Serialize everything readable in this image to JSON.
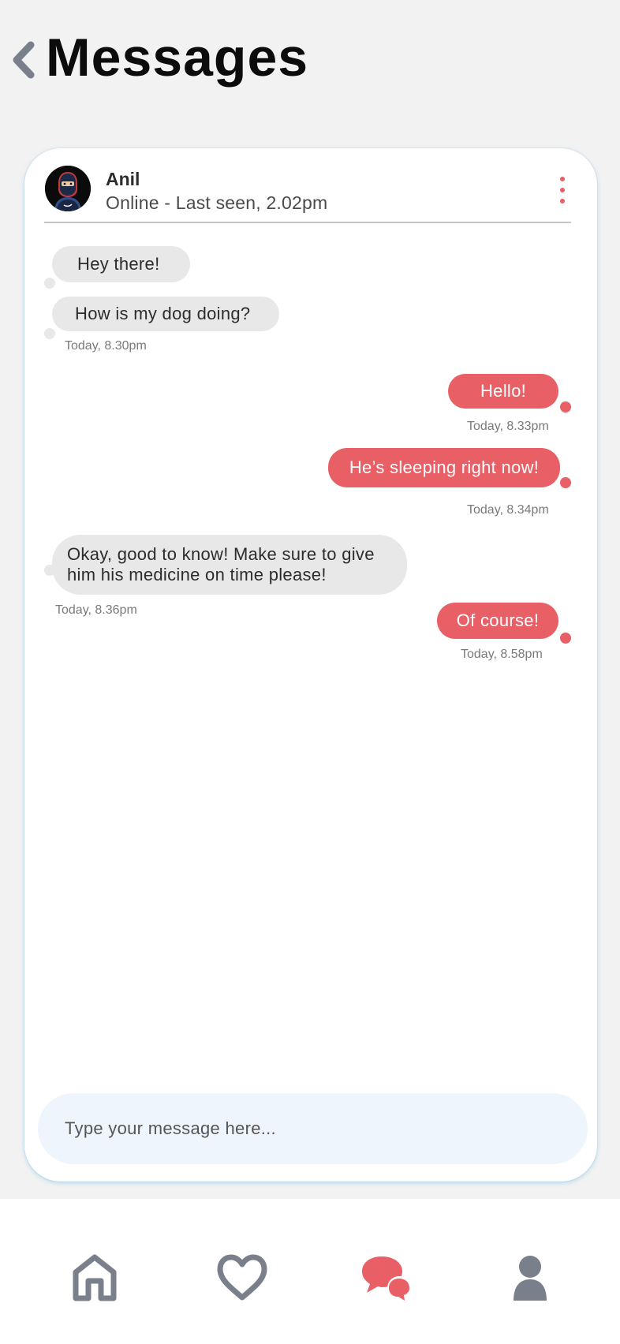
{
  "header": {
    "title": "Messages",
    "back_icon": "chevron-left-icon"
  },
  "contact": {
    "name": "Anil",
    "status": "Online - Last seen, 2.02pm",
    "avatar_icon": "ninja-avatar"
  },
  "messages": [
    {
      "direction": "incoming",
      "text": "Hey there!"
    },
    {
      "direction": "incoming",
      "text": "How is my dog doing?",
      "time": "Today, 8.30pm"
    },
    {
      "direction": "outgoing",
      "text": "Hello!",
      "time": "Today, 8.33pm"
    },
    {
      "direction": "outgoing",
      "text": "He’s sleeping right now!",
      "time": "Today, 8.34pm"
    },
    {
      "direction": "incoming",
      "text_lines": [
        "Okay, good to know! Make sure to give",
        "him his medicine on time please!"
      ],
      "time": "Today, 8.36pm"
    },
    {
      "direction": "outgoing",
      "text": "Of course!",
      "time": "Today, 8.58pm"
    }
  ],
  "composer": {
    "placeholder": "Type your message here..."
  },
  "nav": {
    "items": [
      {
        "icon": "home-icon",
        "active": false
      },
      {
        "icon": "heart-icon",
        "active": false
      },
      {
        "icon": "chat-icon",
        "active": true
      },
      {
        "icon": "user-icon",
        "active": false
      }
    ]
  },
  "colors": {
    "accent": "#e85f66",
    "incoming_bubble": "#e8e8e8",
    "inactive_icon": "#7a808b",
    "background": "#f2f2f2",
    "composer_bg": "#eff5fd"
  }
}
